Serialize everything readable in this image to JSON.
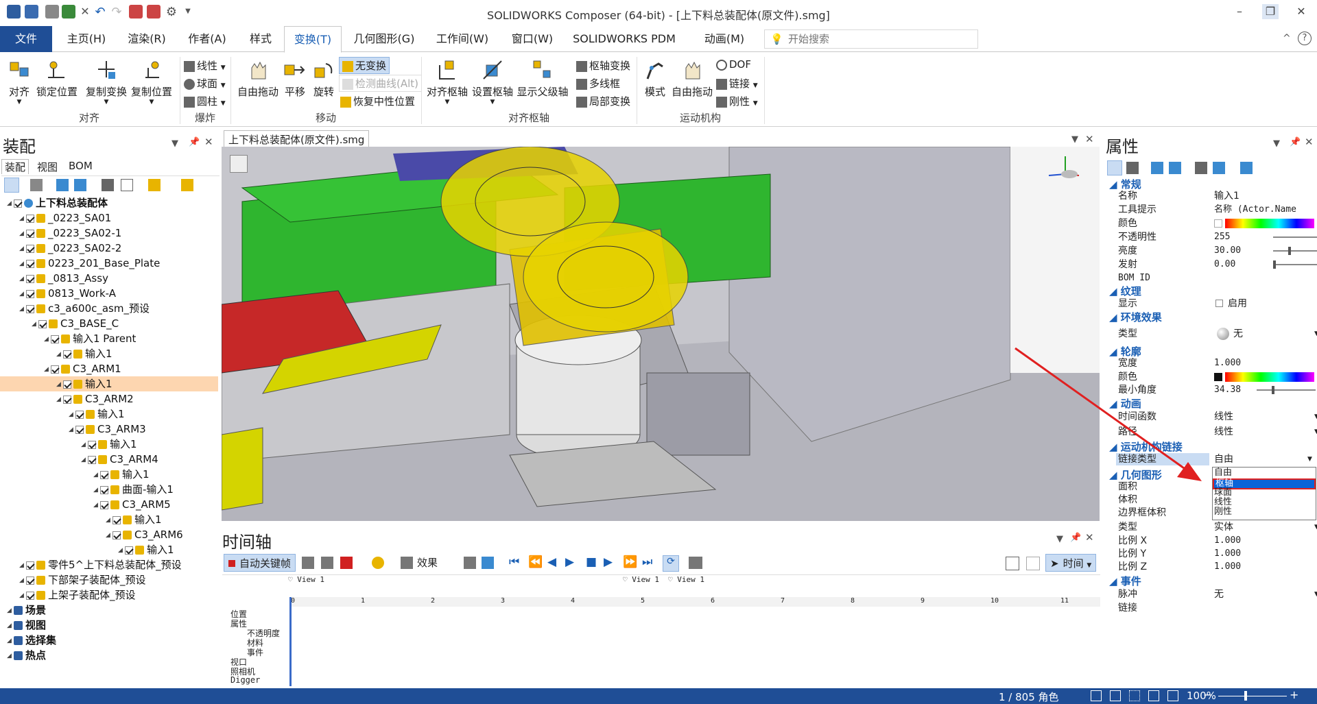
{
  "app": {
    "title": "SOLIDWORKS Composer (64-bit) - [上下料总装配体(原文件).smg]",
    "window_controls": {
      "minimize": "–",
      "restore": "❐",
      "close": "✕"
    },
    "help_icons": {
      "collapse": "^",
      "help": "?"
    }
  },
  "menu": {
    "tabs": [
      {
        "label": "文件"
      },
      {
        "label": "主页(H)"
      },
      {
        "label": "渲染(R)"
      },
      {
        "label": "作者(A)"
      },
      {
        "label": "样式"
      },
      {
        "label": "变换(T)"
      },
      {
        "label": "几何图形(G)"
      },
      {
        "label": "工作间(W)"
      },
      {
        "label": "窗口(W)"
      },
      {
        "label": "SOLIDWORKS PDM"
      },
      {
        "label": "动画(M)"
      }
    ],
    "active_tab": "变换(T)",
    "search_placeholder": "开始搜索"
  },
  "ribbon": {
    "align": {
      "align": "对齐",
      "lock": "锁定位置",
      "copy_transform": "复制变换",
      "copy_position": "复制位置",
      "group": "对齐"
    },
    "explode": {
      "linear": "线性",
      "sphere": "球面",
      "cylinder": "圆柱",
      "group": "爆炸"
    },
    "move": {
      "free_drag": "自由拖动",
      "translate": "平移",
      "rotate": "旋转",
      "no_transform": "无变换",
      "detect_curve": "检测曲线(Alt)",
      "restore_neutral": "恢复中性位置",
      "group": "移动"
    },
    "pivot": {
      "align_pivot": "对齐枢轴",
      "set_pivot": "设置枢轴",
      "show_parent_axis": "显示父级轴",
      "pivot_transform": "枢轴变换",
      "polyline": "多线框",
      "local_transform": "局部变换",
      "group": "对齐枢轴"
    },
    "kinematics": {
      "mode": "模式",
      "free_drag": "自由拖动",
      "dof": "DOF",
      "link": "链接",
      "rigid": "刚性",
      "group": "运动机构"
    }
  },
  "assembly": {
    "title": "装配",
    "tabs": [
      "装配",
      "视图",
      "BOM"
    ],
    "tree": [
      {
        "label": "上下料总装配体",
        "depth": 0,
        "bold": true
      },
      {
        "label": "_0223_SA01",
        "depth": 1
      },
      {
        "label": "_0223_SA02-1",
        "depth": 1
      },
      {
        "label": "_0223_SA02-2",
        "depth": 1
      },
      {
        "label": "0223_201_Base_Plate",
        "depth": 1
      },
      {
        "label": "_0813_Assy",
        "depth": 1
      },
      {
        "label": "0813_Work-A",
        "depth": 1
      },
      {
        "label": "c3_a600c_asm_预设",
        "depth": 1
      },
      {
        "label": "C3_BASE_C",
        "depth": 2
      },
      {
        "label": "输入1 Parent",
        "depth": 3
      },
      {
        "label": "输入1",
        "depth": 4
      },
      {
        "label": "C3_ARM1",
        "depth": 3
      },
      {
        "label": "输入1",
        "depth": 4,
        "selected": true
      },
      {
        "label": "C3_ARM2",
        "depth": 4
      },
      {
        "label": "输入1",
        "depth": 5
      },
      {
        "label": "C3_ARM3",
        "depth": 5
      },
      {
        "label": "输入1",
        "depth": 6
      },
      {
        "label": "C3_ARM4",
        "depth": 6
      },
      {
        "label": "输入1",
        "depth": 7
      },
      {
        "label": "曲面-输入1",
        "depth": 7
      },
      {
        "label": "C3_ARM5",
        "depth": 7
      },
      {
        "label": "输入1",
        "depth": 8
      },
      {
        "label": "C3_ARM6",
        "depth": 8
      },
      {
        "label": "输入1",
        "depth": 9
      },
      {
        "label": "零件5^上下料总装配体_预设",
        "depth": 1
      },
      {
        "label": "下部架子装配体_预设",
        "depth": 1
      },
      {
        "label": "上架子装配体_预设",
        "depth": 1
      },
      {
        "label": "场景",
        "depth": 0,
        "bold": true
      },
      {
        "label": "视图",
        "depth": 0,
        "bold": true
      },
      {
        "label": "选择集",
        "depth": 0,
        "bold": true
      },
      {
        "label": "热点",
        "depth": 0,
        "bold": true
      }
    ]
  },
  "document": {
    "tab": "上下料总装配体(原文件).smg"
  },
  "timeline": {
    "title": "时间轴",
    "auto_key": "自动关键帧",
    "effects": "效果",
    "time": "时间",
    "view_markers": [
      "View 1",
      "View 1",
      "View 1"
    ],
    "ruler": [
      "0",
      "1",
      "2",
      "3",
      "4",
      "5",
      "6",
      "7",
      "8",
      "9",
      "10",
      "11"
    ],
    "tracks": [
      "位置",
      "属性",
      "不透明度",
      "材料",
      "事件",
      "视口",
      "照相机",
      "Digger"
    ]
  },
  "properties": {
    "title": "属性",
    "sections": {
      "general": "常规",
      "texture": "纹理",
      "environment": "环境效果",
      "outline": "轮廓",
      "animation": "动画",
      "kinematic_link": "运动机构链接",
      "geometry": "几何图形",
      "events": "事件"
    },
    "rows": {
      "name": {
        "k": "名称",
        "v": "输入1"
      },
      "tooltip": {
        "k": "工具提示",
        "v": "名称 (Actor.Name"
      },
      "color": {
        "k": "颜色"
      },
      "opacity": {
        "k": "不透明性",
        "v": "255"
      },
      "brightness": {
        "k": "亮度",
        "v": "30.00"
      },
      "emission": {
        "k": "发射",
        "v": "0.00"
      },
      "bom_id": {
        "k": "BOM ID"
      },
      "display": {
        "k": "显示",
        "v": "启用"
      },
      "env_type": {
        "k": "类型",
        "v": "无"
      },
      "width": {
        "k": "宽度",
        "v": "1.000"
      },
      "outline_color": {
        "k": "颜色"
      },
      "min_angle": {
        "k": "最小角度",
        "v": "34.38"
      },
      "time_function": {
        "k": "时间函数",
        "v": "线性"
      },
      "path": {
        "k": "路径",
        "v": "线性"
      },
      "link_type": {
        "k": "链接类型",
        "v": "自由"
      },
      "area": {
        "k": "面积"
      },
      "volume": {
        "k": "体积"
      },
      "bbox_volume": {
        "k": "边界框体积"
      },
      "geo_type": {
        "k": "类型",
        "v": "实体"
      },
      "scale_x": {
        "k": "比例 X",
        "v": "1.000"
      },
      "scale_y": {
        "k": "比例 Y",
        "v": "1.000"
      },
      "scale_z": {
        "k": "比例 Z",
        "v": "1.000"
      },
      "pulse": {
        "k": "脉冲",
        "v": "无"
      },
      "link": {
        "k": "链接"
      }
    },
    "link_type_options": [
      "自由",
      "枢轴",
      "球面",
      "线性",
      "刚性"
    ],
    "highlighted_option": "枢轴"
  },
  "status": {
    "count": "1 / 805 角色",
    "zoom": "100%"
  },
  "colors": {
    "accent": "#1f4e96",
    "selection": "#fdd6b0",
    "annotation_red": "#e02020"
  }
}
